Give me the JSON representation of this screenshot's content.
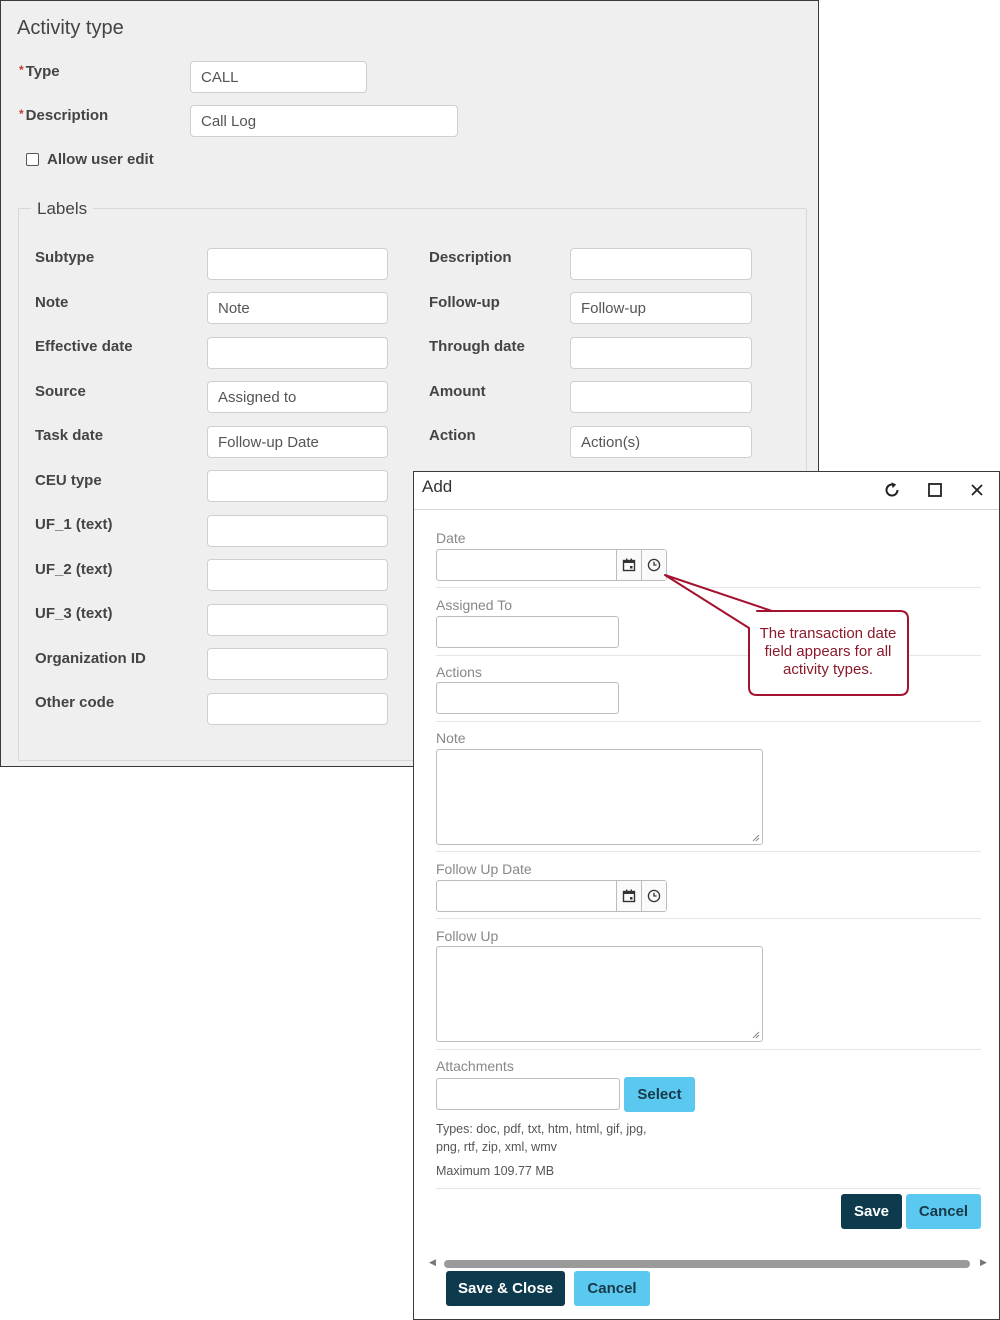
{
  "activity_type": {
    "title": "Activity type",
    "type_label": "Type",
    "type_value": "CALL",
    "description_label": "Description",
    "description_value": "Call Log",
    "allow_user_edit_label": "Allow user edit",
    "allow_user_edit_checked": false,
    "labels": {
      "legend": "Labels",
      "left": [
        {
          "label": "Subtype",
          "value": ""
        },
        {
          "label": "Note",
          "value": "Note"
        },
        {
          "label": "Effective date",
          "value": ""
        },
        {
          "label": "Source",
          "value": "Assigned to"
        },
        {
          "label": "Task date",
          "value": "Follow-up Date"
        },
        {
          "label": "CEU type",
          "value": ""
        },
        {
          "label": "UF_1 (text)",
          "value": ""
        },
        {
          "label": "UF_2 (text)",
          "value": ""
        },
        {
          "label": "UF_3 (text)",
          "value": ""
        },
        {
          "label": "Organization ID",
          "value": ""
        },
        {
          "label": "Other code",
          "value": ""
        }
      ],
      "right": [
        {
          "label": "Description",
          "value": ""
        },
        {
          "label": "Follow-up",
          "value": "Follow-up"
        },
        {
          "label": "Through date",
          "value": ""
        },
        {
          "label": "Amount",
          "value": ""
        },
        {
          "label": "Action",
          "value": "Action(s)"
        }
      ]
    }
  },
  "add_dialog": {
    "title": "Add",
    "icons": {
      "refresh": "refresh-icon",
      "maximize": "maximize-icon",
      "close": "close-icon",
      "calendar": "calendar-icon",
      "clock": "clock-icon"
    },
    "fields": {
      "date_label": "Date",
      "assigned_to_label": "Assigned To",
      "actions_label": "Actions",
      "note_label": "Note",
      "follow_up_date_label": "Follow Up Date",
      "follow_up_label": "Follow Up",
      "attachments_label": "Attachments"
    },
    "select_button": "Select",
    "types_line1": "Types: doc, pdf, txt, htm, html, gif, jpg,",
    "types_line2": "png, rtf, zip, xml, wmv",
    "maximum_text": "Maximum 109.77 MB",
    "save_button": "Save",
    "cancel_button": "Cancel",
    "save_close_button": "Save & Close",
    "cancel_bottom_button": "Cancel"
  },
  "callout": {
    "text": "The transaction date field appears for all activity types."
  },
  "colors": {
    "accent_light": "#5bc8ef",
    "accent_dark": "#0e3a4d",
    "callout": "#a3122f",
    "required_star": "#c0392b"
  }
}
